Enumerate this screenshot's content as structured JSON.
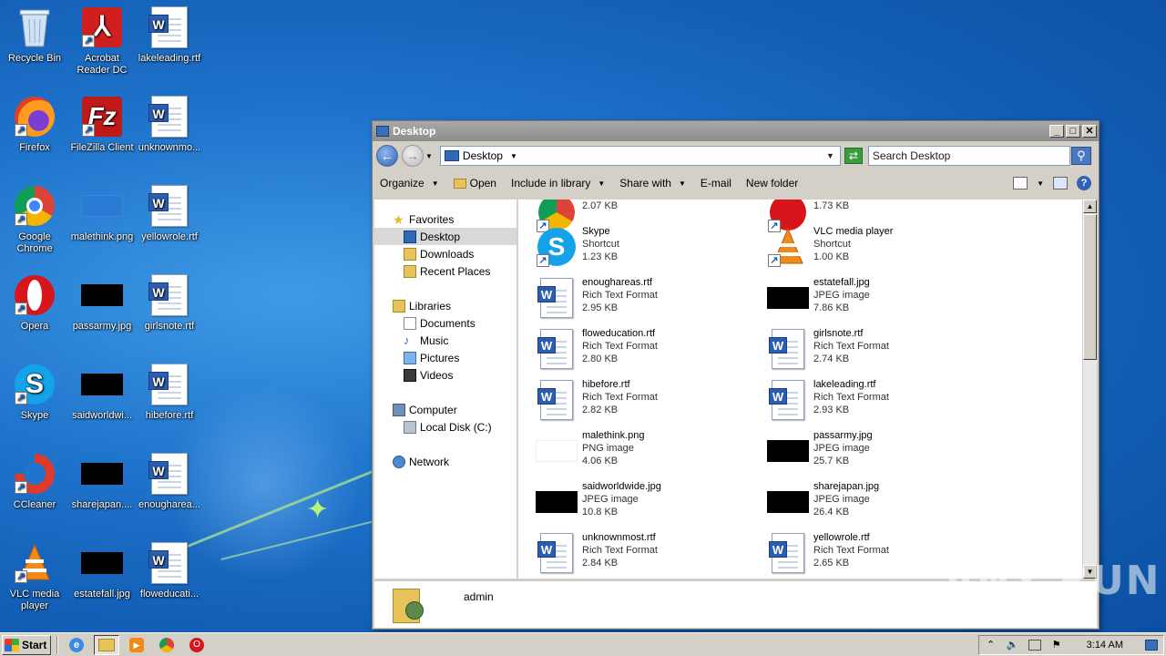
{
  "desktop": {
    "icons": [
      {
        "label": "Recycle Bin"
      },
      {
        "label": "Acrobat Reader DC"
      },
      {
        "label": "lakeleading.rtf"
      },
      {
        "label": "Firefox"
      },
      {
        "label": "FileZilla Client"
      },
      {
        "label": "unknownmo..."
      },
      {
        "label": "Google Chrome"
      },
      {
        "label": "malethink.png"
      },
      {
        "label": "yellowrole.rtf"
      },
      {
        "label": "Opera"
      },
      {
        "label": "passarmy.jpg"
      },
      {
        "label": "girlsnote.rtf"
      },
      {
        "label": "Skype"
      },
      {
        "label": "saidworldwi..."
      },
      {
        "label": "hibefore.rtf"
      },
      {
        "label": "CCleaner"
      },
      {
        "label": "sharejapan...."
      },
      {
        "label": "enoughareа..."
      },
      {
        "label": "VLC media player"
      },
      {
        "label": "estatefall.jpg"
      },
      {
        "label": "floweducati..."
      }
    ]
  },
  "window": {
    "title": "Desktop",
    "address": "Desktop",
    "search_placeholder": "Search Desktop",
    "commands": {
      "organize": "Organize",
      "open": "Open",
      "include": "Include in library",
      "share": "Share with",
      "email": "E-mail",
      "newfolder": "New folder"
    },
    "nav": {
      "favorites": "Favorites",
      "desktop": "Desktop",
      "downloads": "Downloads",
      "recent": "Recent Places",
      "libraries": "Libraries",
      "documents": "Documents",
      "music": "Music",
      "pictures": "Pictures",
      "videos": "Videos",
      "computer": "Computer",
      "localdisk": "Local Disk (C:)",
      "network": "Network"
    },
    "files": [
      {
        "name": "",
        "type": "",
        "size": "2.07 KB"
      },
      {
        "name": "",
        "type": "",
        "size": "1.73 KB"
      },
      {
        "name": "Skype",
        "type": "Shortcut",
        "size": "1.23 KB"
      },
      {
        "name": "VLC media player",
        "type": "Shortcut",
        "size": "1.00 KB"
      },
      {
        "name": "enoughareas.rtf",
        "type": "Rich Text Format",
        "size": "2.95 KB"
      },
      {
        "name": "estatefall.jpg",
        "type": "JPEG image",
        "size": "7.86 KB"
      },
      {
        "name": "floweducation.rtf",
        "type": "Rich Text Format",
        "size": "2.80 KB"
      },
      {
        "name": "girlsnote.rtf",
        "type": "Rich Text Format",
        "size": "2.74 KB"
      },
      {
        "name": "hibefore.rtf",
        "type": "Rich Text Format",
        "size": "2.82 KB"
      },
      {
        "name": "lakeleading.rtf",
        "type": "Rich Text Format",
        "size": "2.93 KB"
      },
      {
        "name": "malethink.png",
        "type": "PNG image",
        "size": "4.06 KB"
      },
      {
        "name": "passarmy.jpg",
        "type": "JPEG image",
        "size": "25.7 KB"
      },
      {
        "name": "saidworldwide.jpg",
        "type": "JPEG image",
        "size": "10.8 KB"
      },
      {
        "name": "sharejapan.jpg",
        "type": "JPEG image",
        "size": "26.4 KB"
      },
      {
        "name": "unknownmost.rtf",
        "type": "Rich Text Format",
        "size": "2.84 KB"
      },
      {
        "name": "yellowrole.rtf",
        "type": "Rich Text Format",
        "size": "2.65 KB"
      }
    ],
    "details_user": "admin"
  },
  "taskbar": {
    "start": "Start",
    "clock": "3:14 AM"
  },
  "watermark": "ANY RUN"
}
